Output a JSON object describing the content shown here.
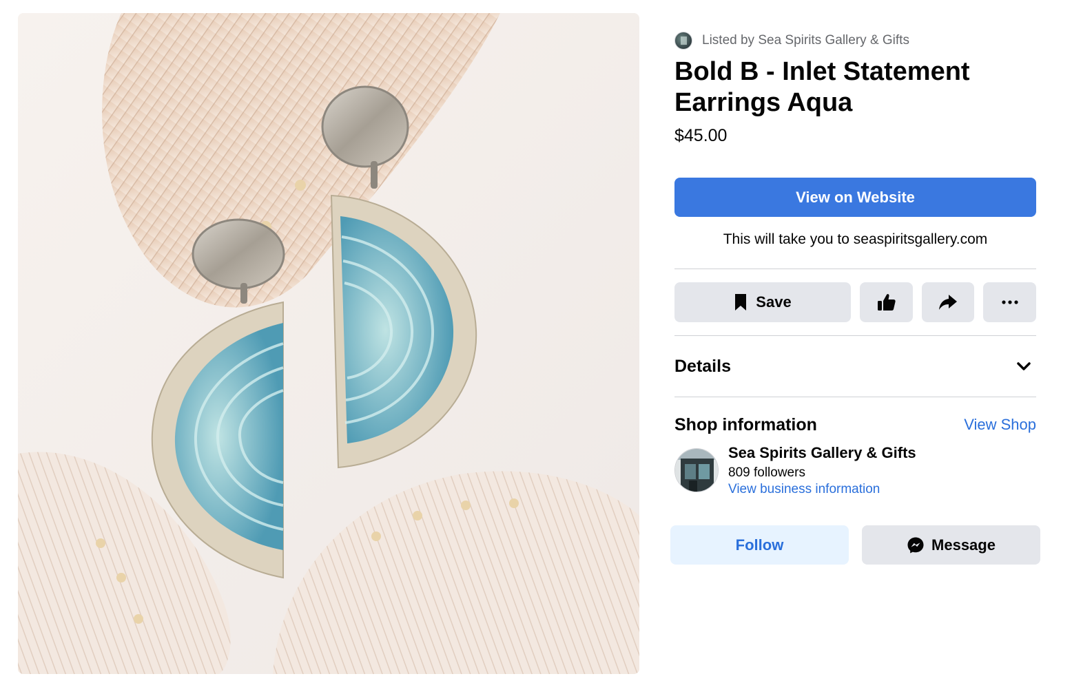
{
  "listing": {
    "listed_by": "Listed by Sea Spirits Gallery & Gifts",
    "title": "Bold B - Inlet Statement Earrings Aqua",
    "price": "$45.00",
    "image_icon": "product-photo-earrings"
  },
  "cta": {
    "view_website": "View on Website",
    "redirect_note": "This will take you to seaspiritsgallery.com",
    "accent_color": "#3a78e0"
  },
  "actions": {
    "save_label": "Save",
    "save_icon": "bookmark-icon",
    "like_icon": "thumbs-up-icon",
    "share_icon": "share-arrow-icon",
    "more_icon": "more-dots-icon"
  },
  "details": {
    "label": "Details",
    "icon": "chevron-down-icon"
  },
  "shop": {
    "heading": "Shop information",
    "view_shop": "View Shop",
    "name": "Sea Spirits Gallery & Gifts",
    "followers": "809 followers",
    "business_link": "View business information",
    "link_color": "#2a6fdb"
  },
  "shop_actions": {
    "follow": "Follow",
    "message": "Message",
    "message_icon": "messenger-icon"
  }
}
